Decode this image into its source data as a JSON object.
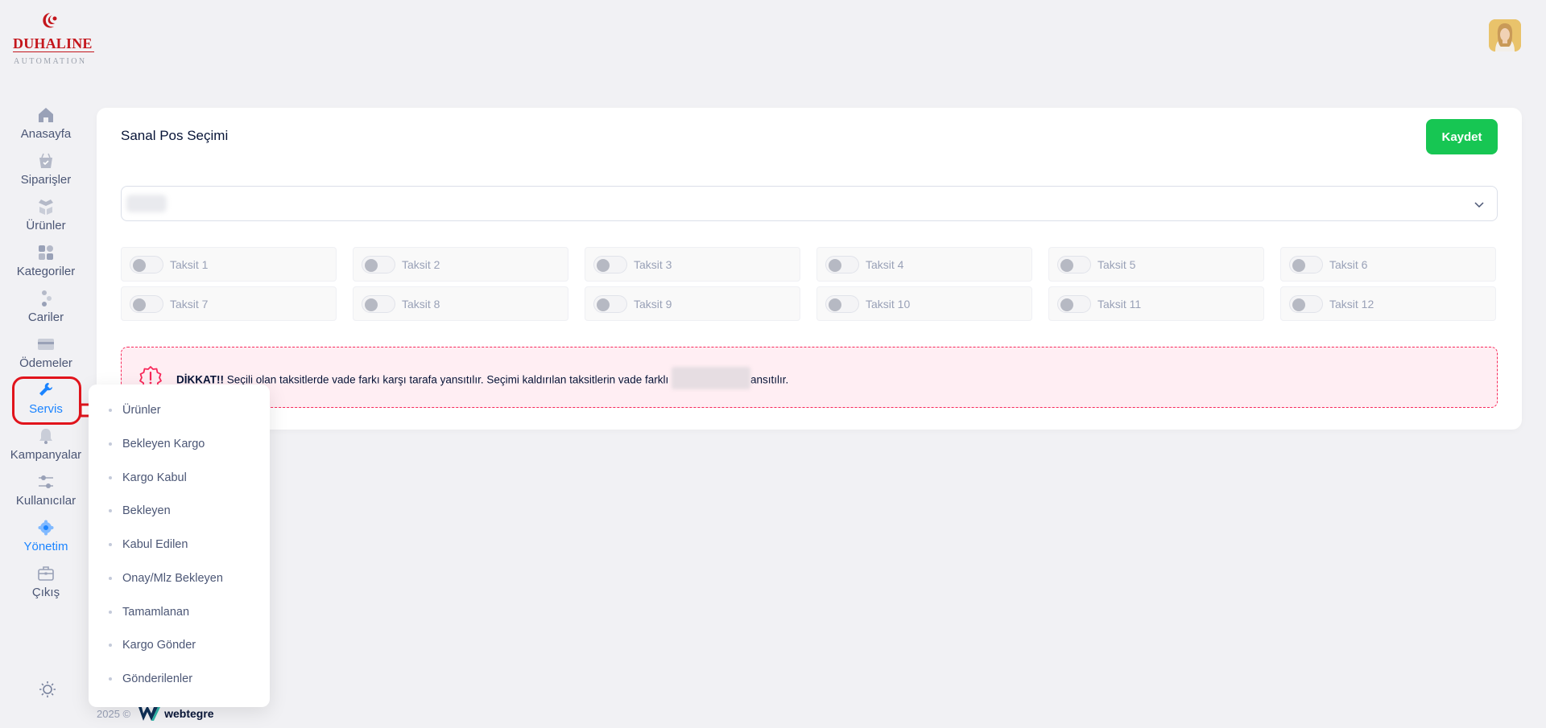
{
  "brand": {
    "name": "DUHALINE",
    "tagline": "AUTOMATION",
    "primary_color": "#c4161c"
  },
  "header": {
    "avatar_icon": "user-avatar"
  },
  "sidebar": {
    "items": [
      {
        "label": "Anasayfa",
        "icon": "home-icon"
      },
      {
        "label": "Siparişler",
        "icon": "basket-icon"
      },
      {
        "label": "Ürünler",
        "icon": "boxes-icon"
      },
      {
        "label": "Kategoriler",
        "icon": "category-icon"
      },
      {
        "label": "Cariler",
        "icon": "people-icon"
      },
      {
        "label": "Ödemeler",
        "icon": "card-icon"
      },
      {
        "label": "Servis",
        "icon": "wrench-icon"
      },
      {
        "label": "Kampanyalar",
        "icon": "bell-icon"
      },
      {
        "label": "Kullanıcılar",
        "icon": "sliders-icon"
      },
      {
        "label": "Yönetim",
        "icon": "gear-icon"
      },
      {
        "label": "Çıkış",
        "icon": "briefcase-icon"
      }
    ],
    "active": "Yönetim",
    "highlighted": "Servis",
    "active_color": "#1b84ff",
    "highlight_border_color": "#e1141c"
  },
  "servis_menu": {
    "items": [
      "Ürünler",
      "Bekleyen Kargo",
      "Kargo Kabul",
      "Bekleyen",
      "Kabul Edilen",
      "Onay/Mlz Bekleyen",
      "Tamamlanan",
      "Kargo Gönder",
      "Gönderilenler"
    ]
  },
  "card": {
    "title": "Sanal Pos Seçimi",
    "save_label": "Kaydet",
    "save_color": "#17c653"
  },
  "installments": [
    {
      "label": "Taksit 1",
      "checked": false
    },
    {
      "label": "Taksit 2",
      "checked": false
    },
    {
      "label": "Taksit 3",
      "checked": false
    },
    {
      "label": "Taksit 4",
      "checked": false
    },
    {
      "label": "Taksit 5",
      "checked": false
    },
    {
      "label": "Taksit 6",
      "checked": false
    },
    {
      "label": "Taksit 7",
      "checked": false
    },
    {
      "label": "Taksit 8",
      "checked": false
    },
    {
      "label": "Taksit 9",
      "checked": false
    },
    {
      "label": "Taksit 10",
      "checked": false
    },
    {
      "label": "Taksit 11",
      "checked": false
    },
    {
      "label": "Taksit 12",
      "checked": false
    }
  ],
  "alert": {
    "prefix": "DİKKAT!!",
    "text_before": " Seçili olan taksitlerde vade farkı karşı tarafa yansıtılır. Seçimi kaldırılan taksitlerin vade farklı ",
    "text_after": "ansıtılır.",
    "color": "#f8285a"
  },
  "footer": {
    "copyright": "2025 ©",
    "company": "webtegre"
  }
}
